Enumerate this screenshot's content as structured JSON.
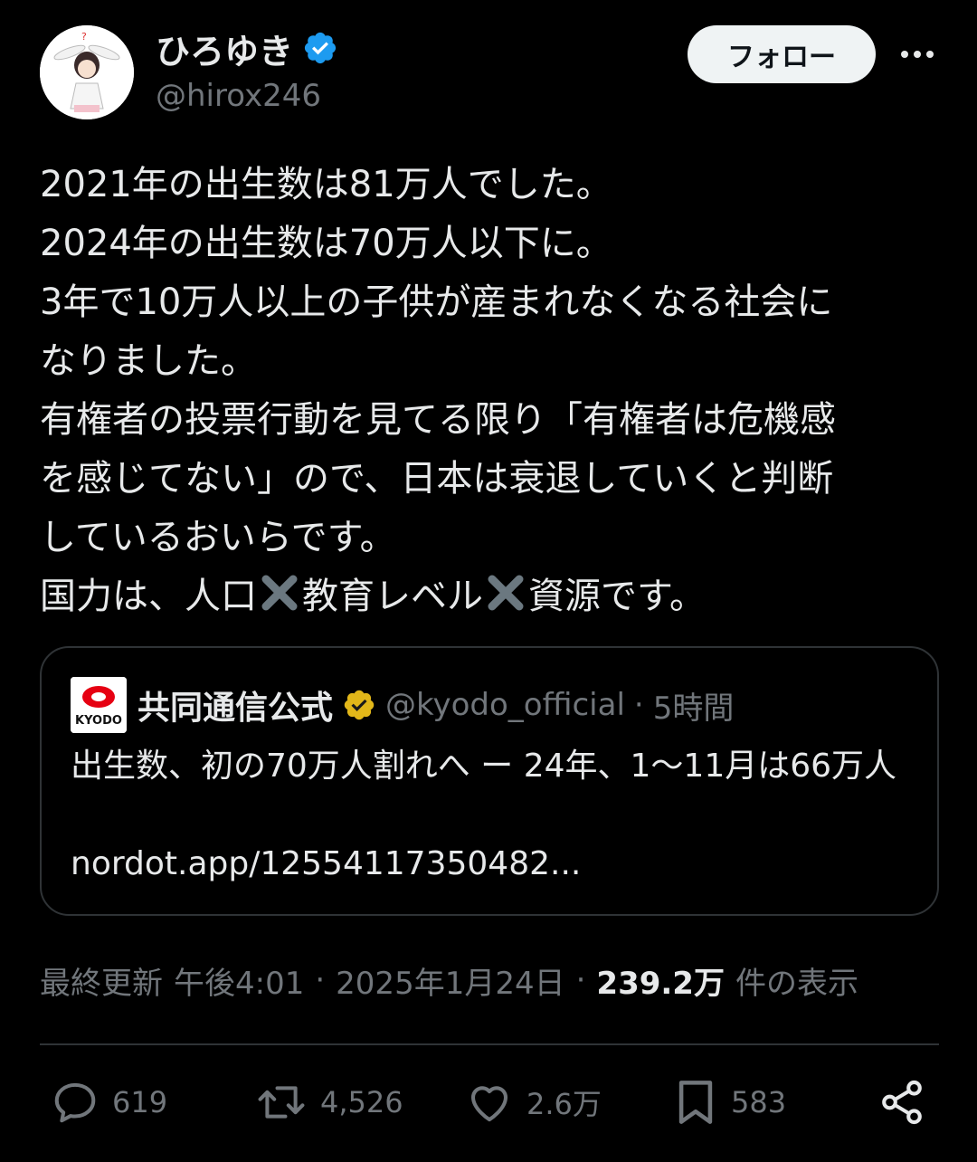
{
  "author": {
    "display_name": "ひろゆき",
    "handle": "@hirox246",
    "verified_color": "#1d9bf0",
    "avatar_icon": "avatar-icon"
  },
  "header": {
    "follow_label": "フォロー",
    "more_icon": "more-icon"
  },
  "tweet": {
    "lines": [
      "2021年の出生数は81万人でした。",
      "2024年の出生数は70万人以下に。",
      "3年で10万人以上の子供が産まれなくなる社会に",
      "なりました。",
      "有権者の投票行動を見てる限り「有権者は危機感",
      "を感じてない」ので、日本は衰退していくと判断",
      "しているおいらです。"
    ],
    "last_line": {
      "part1": "国力は、人口",
      "part2": "教育レベル",
      "part3": "資源です。"
    }
  },
  "quote": {
    "logo_text": "KYODO",
    "name": "共同通信公式",
    "verified_color": "#e2b719",
    "handle": "@kyodo_official",
    "separator": "·",
    "time": "5時間",
    "text": "出生数、初の70万人割れへ ー 24年、1〜11月は66万人",
    "link": "nordot.app/12554117350482..."
  },
  "meta": {
    "updated_label": "最終更新",
    "time": "午後4:01",
    "separator": "·",
    "date": "2025年1月24日",
    "views_count": "239.2万",
    "views_label": "件の表示"
  },
  "actions": {
    "replies": "619",
    "reposts": "4,526",
    "likes": "2.6万",
    "bookmarks": "583"
  },
  "colors": {
    "background": "#000000",
    "text": "#e7e9ea",
    "secondary": "#71767b",
    "border": "#2f3336"
  }
}
